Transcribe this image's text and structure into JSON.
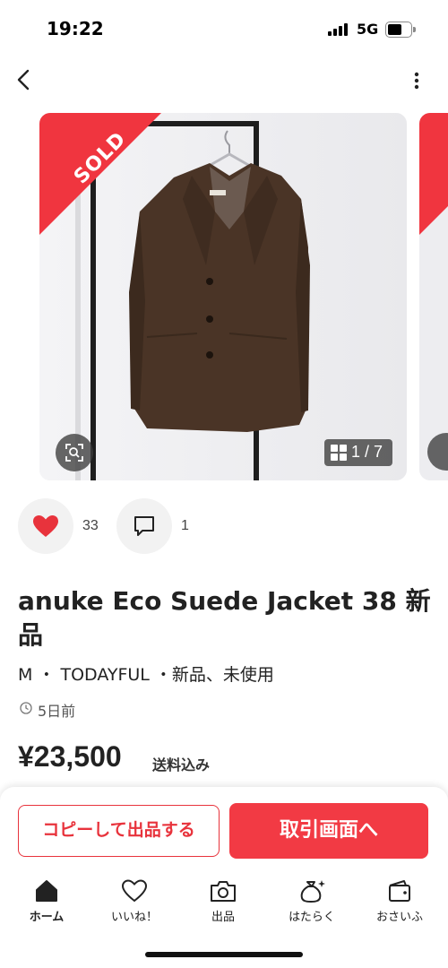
{
  "status_bar": {
    "time": "19:22",
    "network": "5G"
  },
  "navigation": {
    "back_icon": "chevron-left-icon",
    "more_icon": "more-vertical-icon"
  },
  "gallery": {
    "sold_badge": "SOLD",
    "photo_counter": "1 / 7",
    "current_photo": 1,
    "total_photos": 7
  },
  "social": {
    "likes": "33",
    "comments": "1"
  },
  "item": {
    "title": "anuke Eco Suede Jacket 38 新品",
    "meta": "M ・ TODAYFUL ・新品、未使用",
    "posted": "5日前",
    "price": "¥23,500",
    "shipping": "送料込み"
  },
  "actions": {
    "copy_listing": "コピーして出品する",
    "trade_screen": "取引画面へ"
  },
  "tabs": [
    {
      "label": "ホーム",
      "icon": "home-icon",
      "active": true
    },
    {
      "label": "いいね！",
      "icon": "heart-icon",
      "active": false
    },
    {
      "label": "出品",
      "icon": "camera-icon",
      "active": false
    },
    {
      "label": "はたらく",
      "icon": "money-bag-icon",
      "active": false
    },
    {
      "label": "おさいふ",
      "icon": "wallet-icon",
      "active": false
    }
  ],
  "colors": {
    "accent": "#f23a44",
    "sold_ribbon": "#f0353f",
    "jacket": "#4a3426"
  }
}
